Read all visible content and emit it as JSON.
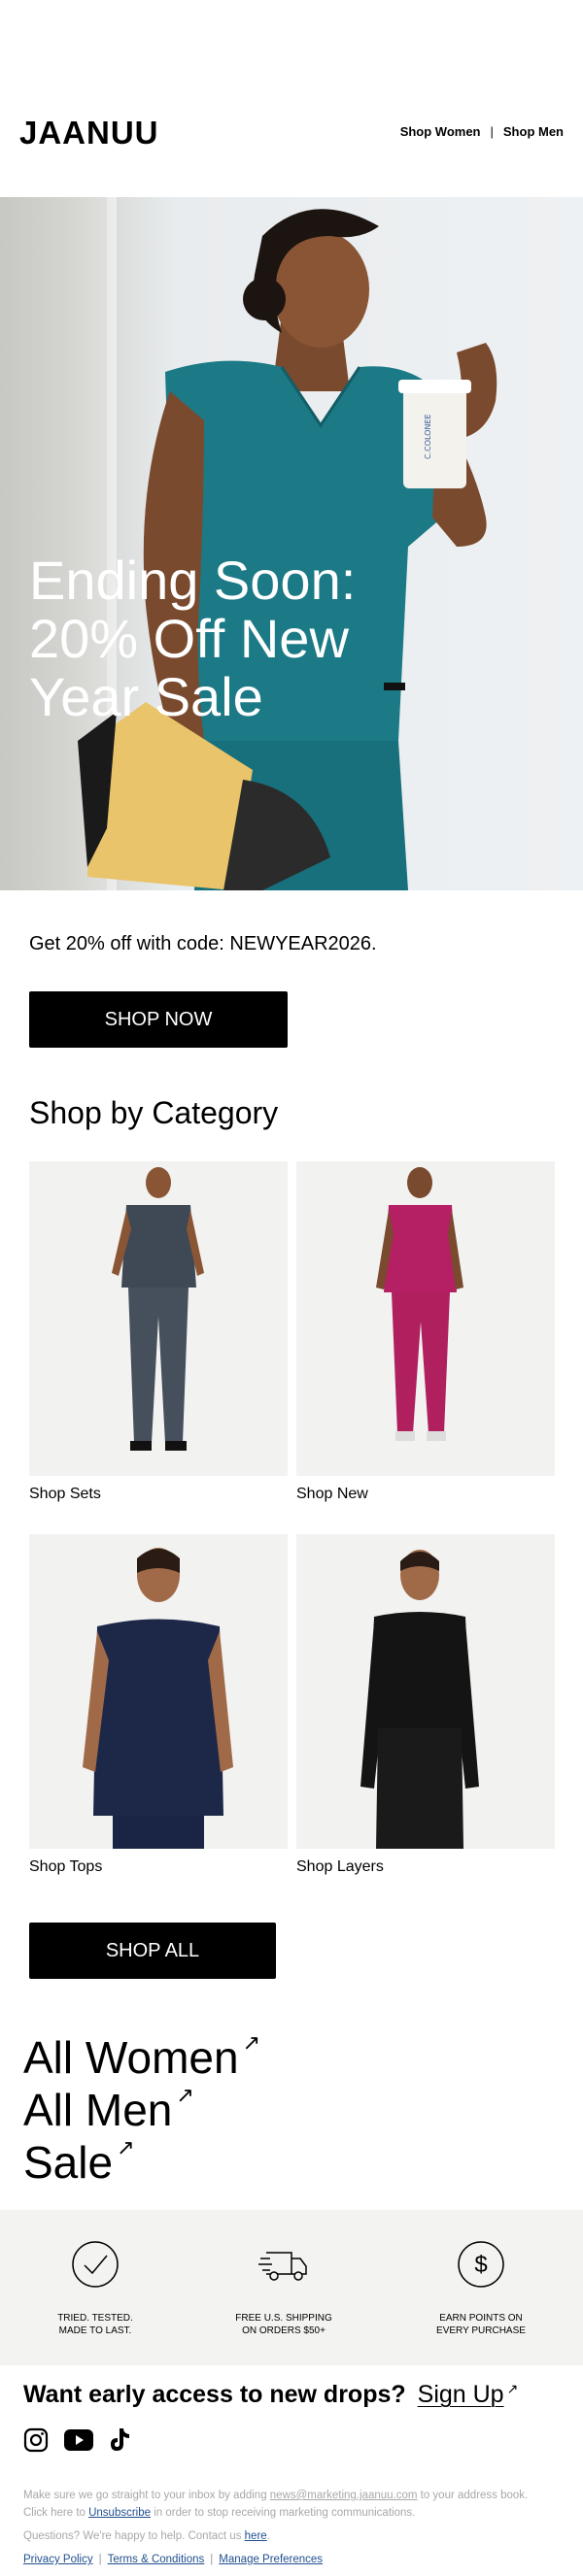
{
  "header": {
    "logo": "JAANUU",
    "nav": [
      {
        "label": "Shop Women"
      },
      {
        "label": "Shop Men"
      }
    ],
    "separator": "|"
  },
  "hero": {
    "title": "Ending Soon: 20% Off New Year Sale",
    "cup_text": "C.COLONEE"
  },
  "promo": {
    "text": "Get 20% off with code: NEWYEAR2026.",
    "button": "SHOP NOW"
  },
  "categories": {
    "title": "Shop by Category",
    "items": [
      {
        "label": "Shop Sets",
        "garment_color": "#3e4955"
      },
      {
        "label": "Shop New",
        "garment_color": "#b51f63"
      },
      {
        "label": "Shop Tops",
        "garment_color": "#1d2849"
      },
      {
        "label": "Shop Layers",
        "garment_color": "#141414"
      }
    ],
    "button": "SHOP ALL"
  },
  "big_links": [
    {
      "label": "All Women",
      "arrow": "↗"
    },
    {
      "label": "All Men",
      "arrow": "↗"
    },
    {
      "label": "Sale",
      "arrow": "↗"
    }
  ],
  "benefits": [
    {
      "icon": "checkmark-circle-icon",
      "line1": "TRIED. TESTED.",
      "line2": "MADE TO LAST."
    },
    {
      "icon": "delivery-truck-icon",
      "line1": "FREE U.S. SHIPPING",
      "line2": "ON ORDERS $50+"
    },
    {
      "icon": "dollar-circle-icon",
      "line1": "EARN POINTS ON",
      "line2": "EVERY PURCHASE"
    }
  ],
  "signup": {
    "text": "Want early access to new drops?",
    "link": "Sign Up",
    "arrow": "↗"
  },
  "socials": [
    {
      "icon": "instagram-icon"
    },
    {
      "icon": "youtube-icon"
    },
    {
      "icon": "tiktok-icon"
    }
  ],
  "fine_print": {
    "line1_a": "Make sure we go straight to your inbox by adding ",
    "email": "news@marketing.jaanuu.com",
    "line1_b": " to your address book.",
    "line2_a": "Click here to ",
    "unsubscribe": "Unsubscribe",
    "line2_b": " in order to stop receiving marketing communications.",
    "help_a": "Questions? We're happy to help. Contact us ",
    "help_link": "here",
    "help_b": "."
  },
  "footer": {
    "links": [
      "Privacy Policy",
      "Terms & Conditions",
      "Manage Preferences"
    ],
    "separator": "|"
  },
  "colors": {
    "hero_scrub": "#1a7a86",
    "button_bg": "#000000",
    "benefits_bg": "#f3f3f2",
    "link_blue": "#1f4f8f"
  }
}
